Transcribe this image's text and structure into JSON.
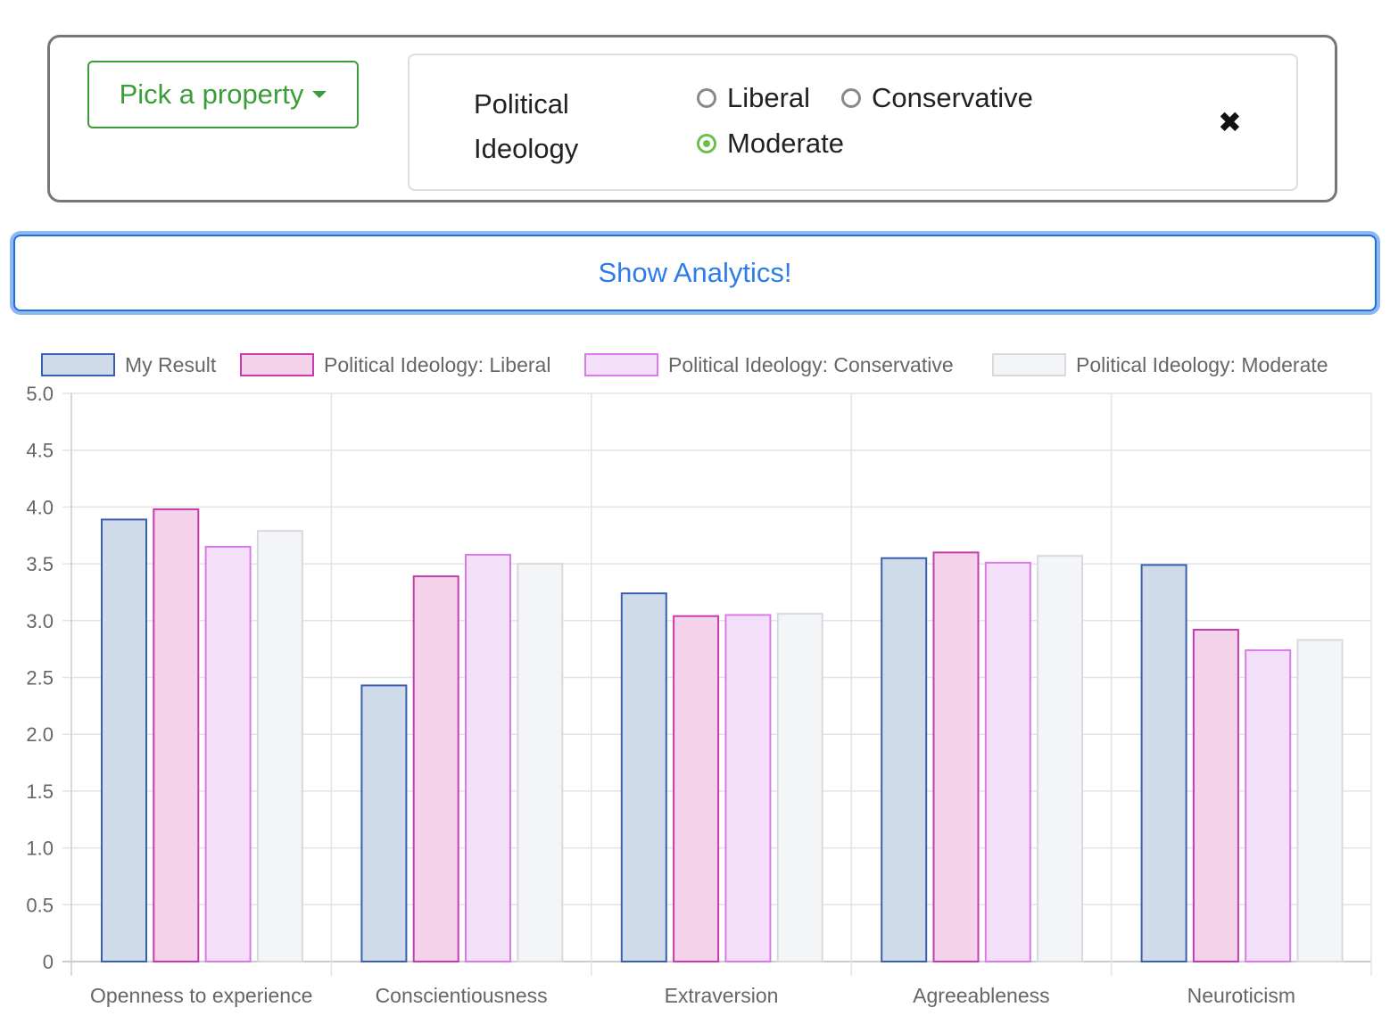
{
  "filter": {
    "pick_label": "Pick a property",
    "property_line1": "Political",
    "property_line2": "Ideology",
    "options": [
      "Liberal",
      "Conservative",
      "Moderate"
    ],
    "selected": "Moderate",
    "close_icon": "close-icon"
  },
  "analytics_button": "Show Analytics!",
  "chart_data": {
    "type": "bar",
    "categories": [
      "Openness to experience",
      "Conscientiousness",
      "Extraversion",
      "Agreeableness",
      "Neuroticism"
    ],
    "series": [
      {
        "name": "My Result",
        "values": [
          3.89,
          2.43,
          3.24,
          3.55,
          3.49
        ],
        "fill": "#d0dbea",
        "stroke": "#3a5fb0"
      },
      {
        "name": "Political Ideology: Liberal",
        "values": [
          3.98,
          3.39,
          3.04,
          3.6,
          2.92
        ],
        "fill": "#f4d3ea",
        "stroke": "#c63cae"
      },
      {
        "name": "Political Ideology: Conservative",
        "values": [
          3.65,
          3.58,
          3.05,
          3.51,
          2.74
        ],
        "fill": "#f4dffa",
        "stroke": "#d87be8"
      },
      {
        "name": "Political Ideology: Moderate",
        "values": [
          3.79,
          3.5,
          3.06,
          3.57,
          2.83
        ],
        "fill": "#f4f5f7",
        "stroke": "#d7d9de"
      }
    ],
    "y_ticks": [
      "5.0",
      "4.5",
      "4.0",
      "3.5",
      "3.0",
      "2.5",
      "2.0",
      "1.5",
      "1.0",
      "0.5",
      "0"
    ],
    "ylim": [
      0,
      5
    ],
    "legend_position": "top",
    "grid": true
  }
}
